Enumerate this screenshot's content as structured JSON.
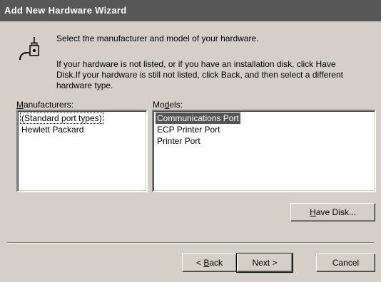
{
  "window": {
    "title": "Add New Hardware Wizard"
  },
  "header": {
    "prompt": "Select the manufacturer and model of your hardware.",
    "instructions_line1": "If your hardware is not listed, or if you have an installation disk, click Have",
    "instructions_line2": "Disk.If your hardware is still not listed, click Back, and then select a different",
    "instructions_line3": "hardware type."
  },
  "manufacturers": {
    "label_prefix": "M",
    "label_rest": "anufacturers:",
    "items": [
      "(Standard port types)",
      "Hewlett Packard"
    ],
    "focused_index": 0
  },
  "models": {
    "label_prefix": "Mo",
    "label_hotkey": "d",
    "label_rest": "els:",
    "items": [
      "Communications Port",
      "ECP Printer Port",
      "Printer Port"
    ],
    "selected_index": 0
  },
  "buttons": {
    "have_disk_hotkey": "H",
    "have_disk_rest": "ave Disk...",
    "back_prefix": "< ",
    "back_hotkey": "B",
    "back_rest": "ack",
    "next": "Next >",
    "cancel": "Cancel"
  },
  "icons": {
    "wizard": "serial-cable-icon"
  }
}
